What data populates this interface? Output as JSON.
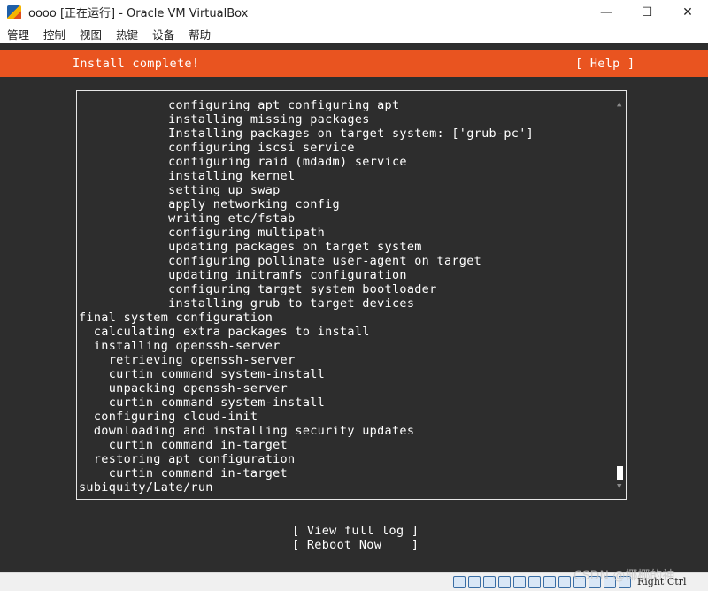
{
  "window": {
    "title": "oooo [正在运行] - Oracle VM VirtualBox",
    "controls": {
      "minimize": "—",
      "maximize": "☐",
      "close": "✕"
    }
  },
  "menu": [
    "管理",
    "控制",
    "视图",
    "热键",
    "设备",
    "帮助"
  ],
  "installer": {
    "banner_title": "Install complete!",
    "help_label": "[ Help ]",
    "accent_color": "#e95420",
    "log_lines": [
      "            configuring apt configuring apt",
      "            installing missing packages",
      "            Installing packages on target system: ['grub-pc']",
      "            configuring iscsi service",
      "            configuring raid (mdadm) service",
      "            installing kernel",
      "            setting up swap",
      "            apply networking config",
      "            writing etc/fstab",
      "            configuring multipath",
      "            updating packages on target system",
      "            configuring pollinate user-agent on target",
      "            updating initramfs configuration",
      "            configuring target system bootloader",
      "            installing grub to target devices",
      "final system configuration",
      "  calculating extra packages to install",
      "  installing openssh-server",
      "    retrieving openssh-server",
      "    curtin command system-install",
      "    unpacking openssh-server",
      "    curtin command system-install",
      "  configuring cloud-init",
      "  downloading and installing security updates",
      "    curtin command in-target",
      "  restoring apt configuration",
      "    curtin command in-target",
      "subiquity/Late/run"
    ],
    "scroll_up_icon": "▲",
    "scroll_down_icon": "▼",
    "view_log_label": "[ View full log ]",
    "reboot_label": "[ Reboot Now    ]"
  },
  "statusbar": {
    "icons": [
      "hard-disk-icon",
      "optical-disk-icon",
      "audio-icon",
      "network-icon",
      "usb-icon",
      "shared-folder-icon",
      "display-icon",
      "recording-icon",
      "video-capture-icon",
      "cpu-icon",
      "mouse-integration-icon",
      "keyboard-icon"
    ],
    "host_key": "Right Ctrl"
  },
  "watermark": "CSDN @椰椰的神"
}
